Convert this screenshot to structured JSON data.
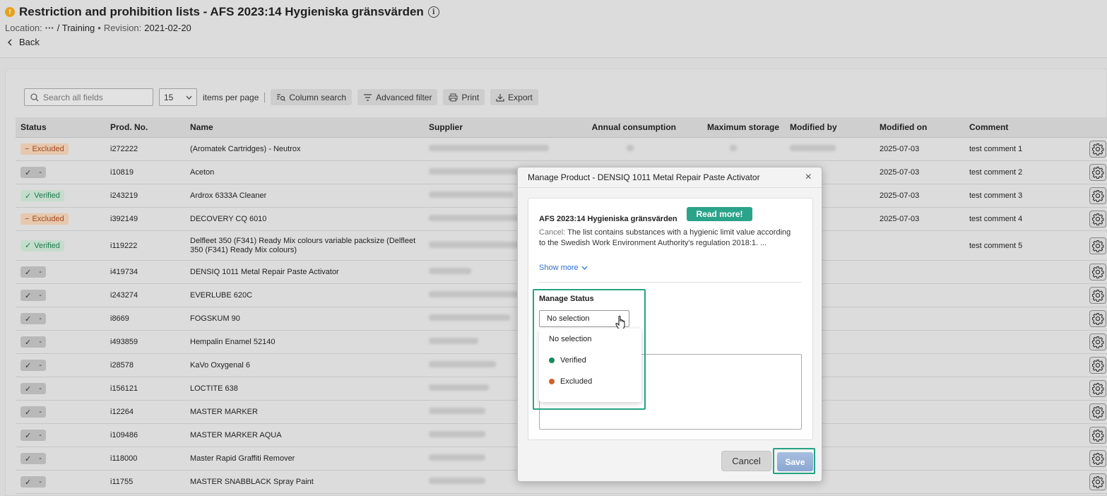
{
  "header": {
    "title": "Restriction and prohibition lists - AFS 2023:14 Hygieniska gränsvärden",
    "location_label": "Location:",
    "location_ellipsis": "···",
    "location_path": "/ Training",
    "bullet": "•",
    "revision_label": "Revision:",
    "revision_value": "2021-02-20",
    "back_label": "Back"
  },
  "toolbar": {
    "search_placeholder": "Search all fields",
    "per_page_value": "15",
    "per_page_label": "items per page",
    "column_search": "Column search",
    "advanced_filter": "Advanced filter",
    "print": "Print",
    "export": "Export"
  },
  "table": {
    "columns": [
      "Status",
      "Prod. No.",
      "Name",
      "Supplier",
      "Annual consumption",
      "Maximum storage",
      "Modified by",
      "Modified on",
      "Comment"
    ],
    "rows": [
      {
        "status": "excluded",
        "status_label": "Excluded",
        "prod": "i272222",
        "name": "(Aromatek Cartridges) - Neutrox",
        "modified_on": "2025-07-03",
        "comment": "test comment 1"
      },
      {
        "status": "none",
        "status_label": "-",
        "prod": "i10819",
        "name": "Aceton",
        "modified_on": "2025-07-03",
        "comment": "test comment 2"
      },
      {
        "status": "verified",
        "status_label": "Verified",
        "prod": "i243219",
        "name": "Ardrox 6333A Cleaner",
        "modified_on": "2025-07-03",
        "comment": "test comment 3"
      },
      {
        "status": "excluded",
        "status_label": "Excluded",
        "prod": "i392149",
        "name": "DECOVERY CQ 6010",
        "modified_on": "2025-07-03",
        "comment": "test comment 4"
      },
      {
        "status": "verified",
        "status_label": "Verified",
        "prod": "i119222",
        "name": "Delfleet 350 (F341) Ready Mix colours variable packsize (Delfleet 350 (F341) Ready Mix colours)",
        "modified_on": "",
        "comment": "test comment 5"
      },
      {
        "status": "none",
        "status_label": "-",
        "prod": "i419734",
        "name": "DENSIQ 1011 Metal Repair Paste Activator",
        "modified_on": "",
        "comment": ""
      },
      {
        "status": "none",
        "status_label": "-",
        "prod": "i243274",
        "name": "EVERLUBE 620C",
        "modified_on": "",
        "comment": ""
      },
      {
        "status": "none",
        "status_label": "-",
        "prod": "i8669",
        "name": "FOGSKUM 90",
        "modified_on": "",
        "comment": ""
      },
      {
        "status": "none",
        "status_label": "-",
        "prod": "i493859",
        "name": "Hempalin Enamel 52140",
        "modified_on": "",
        "comment": ""
      },
      {
        "status": "none",
        "status_label": "-",
        "prod": "i28578",
        "name": "KaVo Oxygenal 6",
        "modified_on": "",
        "comment": ""
      },
      {
        "status": "none",
        "status_label": "-",
        "prod": "i156121",
        "name": "LOCTITE 638",
        "modified_on": "",
        "comment": ""
      },
      {
        "status": "none",
        "status_label": "-",
        "prod": "i12264",
        "name": "MASTER MARKER",
        "modified_on": "",
        "comment": ""
      },
      {
        "status": "none",
        "status_label": "-",
        "prod": "i109486",
        "name": "MASTER MARKER AQUA",
        "modified_on": "",
        "comment": ""
      },
      {
        "status": "none",
        "status_label": "-",
        "prod": "i118000",
        "name": "Master Rapid Graffiti Remover",
        "modified_on": "",
        "comment": ""
      },
      {
        "status": "none",
        "status_label": "-",
        "prod": "i11755",
        "name": "MASTER SNABBLACK Spray Paint",
        "modified_on": "",
        "comment": ""
      }
    ]
  },
  "modal": {
    "title": "Manage Product - DENSIQ 1011 Metal Repair Paste Activator",
    "close": "×",
    "list_title": "AFS 2023:14 Hygieniska gränsvärden",
    "read_more": "Read more!",
    "desc_label": "Cancel:",
    "desc_text": "The list contains substances with a hygienic limit value according to the Swedish Work Environment Authority's regulation 2018:1. ...",
    "show_more": "Show more",
    "manage_status_label": "Manage Status",
    "select_value": "No selection",
    "options": [
      {
        "label": "No selection",
        "color": ""
      },
      {
        "label": "Verified",
        "color": "#178a5c"
      },
      {
        "label": "Excluded",
        "color": "#d2622c"
      }
    ],
    "cancel": "Cancel",
    "save": "Save"
  },
  "colors": {
    "accent": "#25a382",
    "verified": "#1d7a4a",
    "excluded": "#a54a1c",
    "link": "#2b6fd1"
  }
}
